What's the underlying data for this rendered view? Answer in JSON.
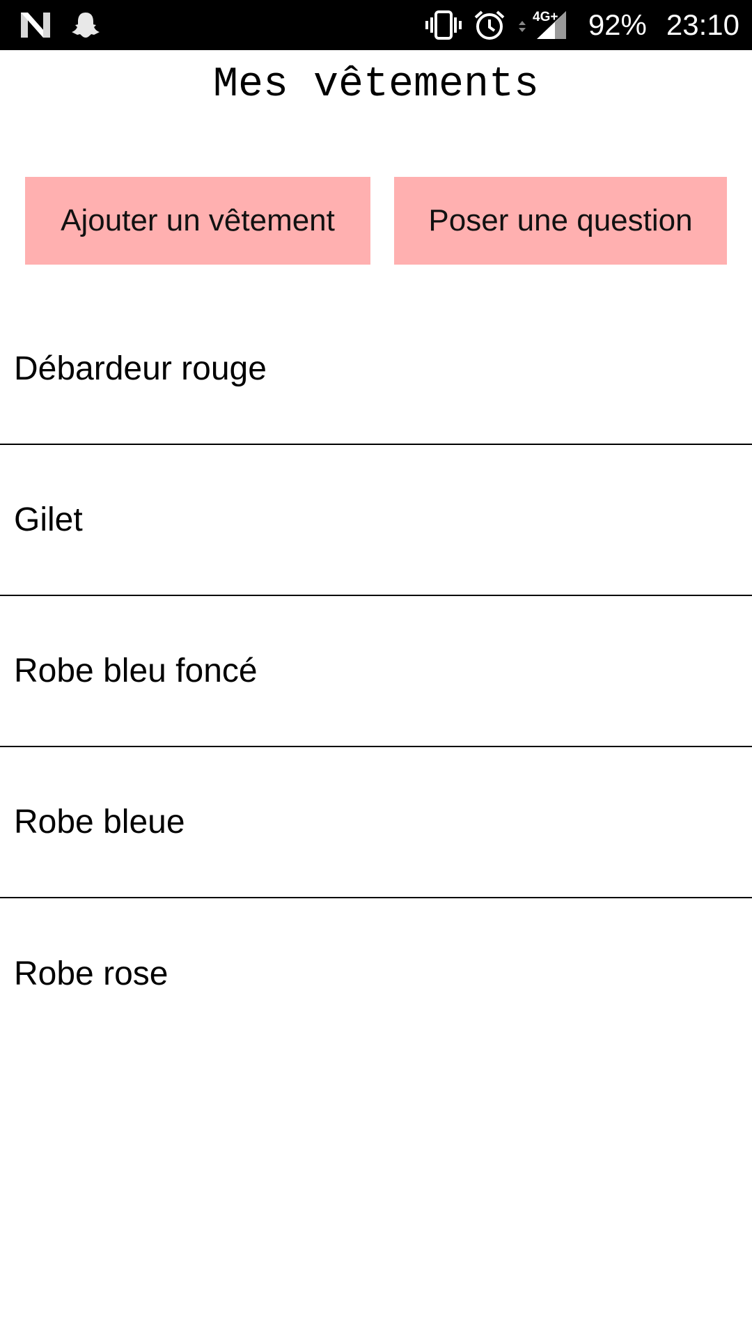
{
  "status_bar": {
    "left_icons": [
      "n-notification-icon",
      "snapchat-ghost-icon"
    ],
    "right_icons": [
      "vibrate-icon",
      "alarm-clock-icon",
      "network-4g-signal-icon"
    ],
    "network_label": "4G+",
    "battery": "92%",
    "time": "23:10"
  },
  "header": {
    "title": "Mes vêtements"
  },
  "actions": {
    "add_label": "Ajouter un vêtement",
    "ask_label": "Poser une question",
    "button_color": "#ffb0b0"
  },
  "clothes": {
    "items": [
      {
        "label": "Débardeur rouge"
      },
      {
        "label": "Gilet"
      },
      {
        "label": "Robe bleu foncé"
      },
      {
        "label": "Robe bleue"
      },
      {
        "label": "Robe rose"
      }
    ]
  }
}
